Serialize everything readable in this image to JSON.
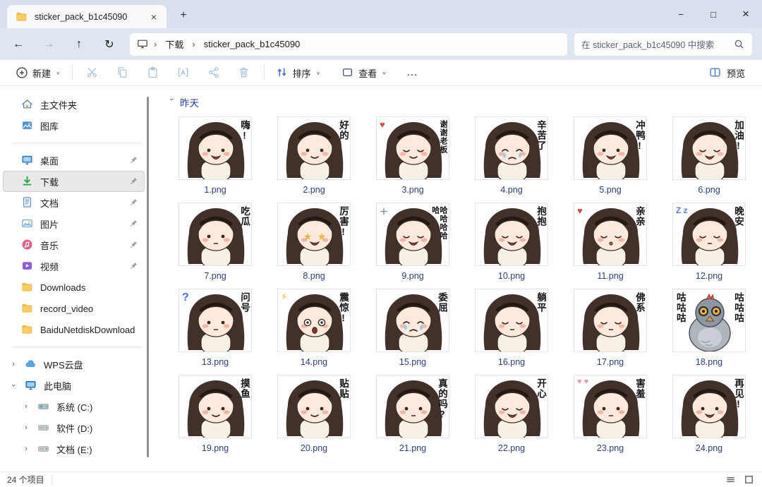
{
  "window": {
    "tab_title": "sticker_pack_b1c45090",
    "new_tab_label": "+",
    "controls": {
      "minimize": "−",
      "maximize": "□",
      "close": "×"
    }
  },
  "address_bar": {
    "crumbs": [
      "下载",
      "sticker_pack_b1c45090"
    ],
    "separator": "›",
    "search_placeholder": "在 sticker_pack_b1c45090 中搜索"
  },
  "toolbar": {
    "new_label": "新建",
    "sort_label": "排序",
    "view_label": "查看",
    "more_label": "…",
    "preview_label": "预览",
    "disabled_icons": [
      "cut",
      "copy",
      "paste",
      "rename",
      "share",
      "delete"
    ]
  },
  "colors": {
    "accent_blue": "#4b7bd0",
    "download_green": "#2aa84e",
    "folder_yellow": "#fbce5f",
    "titlebar": "#d7e0ec",
    "group_label_blue": "#2c3c9c"
  },
  "sidebar": {
    "sections": [
      {
        "items": [
          {
            "label": "主文件夹",
            "icon": "home"
          },
          {
            "label": "图库",
            "icon": "gallery"
          }
        ]
      },
      {
        "items": [
          {
            "label": "桌面",
            "icon": "desktop",
            "pinned": true
          },
          {
            "label": "下载",
            "icon": "downloads",
            "pinned": true,
            "selected": true
          },
          {
            "label": "文档",
            "icon": "documents",
            "pinned": true
          },
          {
            "label": "图片",
            "icon": "pictures",
            "pinned": true
          },
          {
            "label": "音乐",
            "icon": "music",
            "pinned": true
          },
          {
            "label": "视频",
            "icon": "videos",
            "pinned": true
          },
          {
            "label": "Downloads",
            "icon": "folder"
          },
          {
            "label": "record_video",
            "icon": "folder"
          },
          {
            "label": "BaiduNetdiskDownload",
            "icon": "folder"
          }
        ]
      },
      {
        "items": [
          {
            "label": "WPS云盘",
            "icon": "cloud",
            "expander": "collapsed"
          },
          {
            "label": "此电脑",
            "icon": "computer",
            "expander": "expanded"
          },
          {
            "label": "系统 (C:)",
            "icon": "drive-c",
            "expander": "collapsed",
            "indent": 1
          },
          {
            "label": "软件 (D:)",
            "icon": "drive",
            "expander": "collapsed",
            "indent": 1
          },
          {
            "label": "文档 (E:)",
            "icon": "drive",
            "expander": "collapsed",
            "indent": 1
          }
        ]
      }
    ]
  },
  "content": {
    "group_label": "昨天",
    "files": [
      {
        "name": "1.png",
        "caption": "嗨!",
        "eyes": "open",
        "mouth": "open"
      },
      {
        "name": "2.png",
        "caption": "好的",
        "eyes": "open",
        "mouth": "smile"
      },
      {
        "name": "3.png",
        "caption": "谢谢老板",
        "eyes": "closed",
        "mouth": "smile",
        "extra": "heart"
      },
      {
        "name": "4.png",
        "caption": "辛苦了",
        "eyes": "cry",
        "mouth": "frown"
      },
      {
        "name": "5.png",
        "caption": "冲鸭!",
        "eyes": "open",
        "mouth": "open"
      },
      {
        "name": "6.png",
        "caption": "加油!",
        "eyes": "closed",
        "mouth": "open"
      },
      {
        "name": "7.png",
        "caption": "吃瓜",
        "eyes": "open",
        "mouth": "small"
      },
      {
        "name": "8.png",
        "caption": "厉害!",
        "eyes": "star",
        "mouth": "open"
      },
      {
        "name": "9.png",
        "caption": "哈哈哈哈哈",
        "eyes": "closed",
        "mouth": "open",
        "extra": "sparkle"
      },
      {
        "name": "10.png",
        "caption": "抱抱",
        "eyes": "closed",
        "mouth": "open"
      },
      {
        "name": "11.png",
        "caption": "亲亲",
        "eyes": "closed",
        "mouth": "pout",
        "extra": "heart"
      },
      {
        "name": "12.png",
        "caption": "晚安",
        "eyes": "closed",
        "mouth": "small",
        "extra": "sleep"
      },
      {
        "name": "13.png",
        "caption": "问号",
        "eyes": "open",
        "mouth": "small",
        "extra": "question"
      },
      {
        "name": "14.png",
        "caption": "震惊!",
        "eyes": "wide",
        "mouth": "shock",
        "extra": "lightning"
      },
      {
        "name": "15.png",
        "caption": "委屈",
        "eyes": "cry",
        "mouth": "frown"
      },
      {
        "name": "16.png",
        "caption": "躺平",
        "eyes": "closed",
        "mouth": "small"
      },
      {
        "name": "17.png",
        "caption": "佛系",
        "eyes": "closed",
        "mouth": "small"
      },
      {
        "name": "18.png",
        "caption": "咕咕咕",
        "caption_left": "咕咕咕",
        "variant": "pigeon"
      },
      {
        "name": "19.png",
        "caption": "摸鱼",
        "eyes": "open",
        "mouth": "smile"
      },
      {
        "name": "20.png",
        "caption": "贴贴",
        "eyes": "open",
        "mouth": "smile"
      },
      {
        "name": "21.png",
        "caption": "真的吗?",
        "eyes": "open",
        "mouth": "small"
      },
      {
        "name": "22.png",
        "caption": "开心",
        "eyes": "closed",
        "mouth": "open"
      },
      {
        "name": "23.png",
        "caption": "害羞",
        "eyes": "open",
        "mouth": "small",
        "extra": "hearts"
      },
      {
        "name": "24.png",
        "caption": "再见!",
        "eyes": "open",
        "mouth": "open"
      }
    ]
  },
  "status_bar": {
    "items_count": "24 个项目"
  }
}
